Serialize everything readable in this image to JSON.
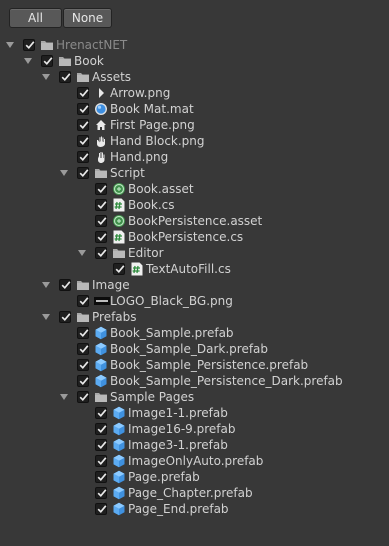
{
  "toolbar": {
    "all_label": "All",
    "none_label": "None"
  },
  "tree": [
    {
      "label": "HrenactNET",
      "icon": "folder-icon",
      "depth": 0,
      "expanded": true,
      "checked": true,
      "dim": true
    },
    {
      "label": "Book",
      "icon": "folder-icon",
      "depth": 1,
      "expanded": true,
      "checked": true
    },
    {
      "label": "Assets",
      "icon": "folder-icon",
      "depth": 2,
      "expanded": true,
      "checked": true
    },
    {
      "label": "Arrow.png",
      "icon": "arrow-image-icon",
      "depth": 3,
      "checked": true
    },
    {
      "label": "Book Mat.mat",
      "icon": "material-icon",
      "depth": 3,
      "checked": true
    },
    {
      "label": "First Page.png",
      "icon": "house-image-icon",
      "depth": 3,
      "checked": true
    },
    {
      "label": "Hand Block.png",
      "icon": "hand-block-image-icon",
      "depth": 3,
      "checked": true
    },
    {
      "label": "Hand.png",
      "icon": "hand-image-icon",
      "depth": 3,
      "checked": true
    },
    {
      "label": "Script",
      "icon": "folder-icon",
      "depth": 3,
      "expanded": true,
      "checked": true
    },
    {
      "label": "Book.asset",
      "icon": "scriptable-asset-icon",
      "depth": 4,
      "checked": true
    },
    {
      "label": "Book.cs",
      "icon": "csharp-script-icon",
      "depth": 4,
      "checked": true
    },
    {
      "label": "BookPersistence.asset",
      "icon": "scriptable-asset-icon",
      "depth": 4,
      "checked": true
    },
    {
      "label": "BookPersistence.cs",
      "icon": "csharp-script-icon",
      "depth": 4,
      "checked": true
    },
    {
      "label": "Editor",
      "icon": "folder-icon",
      "depth": 4,
      "expanded": true,
      "checked": true
    },
    {
      "label": "TextAutoFill.cs",
      "icon": "csharp-script-icon",
      "depth": 5,
      "checked": true
    },
    {
      "label": "Image",
      "icon": "folder-icon",
      "depth": 2,
      "expanded": true,
      "checked": true
    },
    {
      "label": "LOGO_Black_BG.png",
      "icon": "logo-image-icon",
      "depth": 3,
      "checked": true
    },
    {
      "label": "Prefabs",
      "icon": "folder-icon",
      "depth": 2,
      "expanded": true,
      "checked": true
    },
    {
      "label": "Book_Sample.prefab",
      "icon": "prefab-icon",
      "depth": 3,
      "checked": true
    },
    {
      "label": "Book_Sample_Dark.prefab",
      "icon": "prefab-icon",
      "depth": 3,
      "checked": true
    },
    {
      "label": "Book_Sample_Persistence.prefab",
      "icon": "prefab-icon",
      "depth": 3,
      "checked": true
    },
    {
      "label": "Book_Sample_Persistence_Dark.prefab",
      "icon": "prefab-icon",
      "depth": 3,
      "checked": true
    },
    {
      "label": "Sample Pages",
      "icon": "folder-icon",
      "depth": 3,
      "expanded": true,
      "checked": true
    },
    {
      "label": "Image1-1.prefab",
      "icon": "prefab-icon",
      "depth": 4,
      "checked": true
    },
    {
      "label": "Image16-9.prefab",
      "icon": "prefab-icon",
      "depth": 4,
      "checked": true
    },
    {
      "label": "Image3-1.prefab",
      "icon": "prefab-icon",
      "depth": 4,
      "checked": true
    },
    {
      "label": "ImageOnlyAuto.prefab",
      "icon": "prefab-icon",
      "depth": 4,
      "checked": true
    },
    {
      "label": "Page.prefab",
      "icon": "prefab-icon",
      "depth": 4,
      "checked": true
    },
    {
      "label": "Page_Chapter.prefab",
      "icon": "prefab-icon",
      "depth": 4,
      "checked": true
    },
    {
      "label": "Page_End.prefab",
      "icon": "prefab-icon",
      "depth": 4,
      "checked": true
    }
  ],
  "colors": {
    "background": "#383838",
    "folder": "#a8a8a8",
    "prefab": "#5aa5e6",
    "script_green": "#4fa35a",
    "checkbox": "#1f1f1f"
  }
}
